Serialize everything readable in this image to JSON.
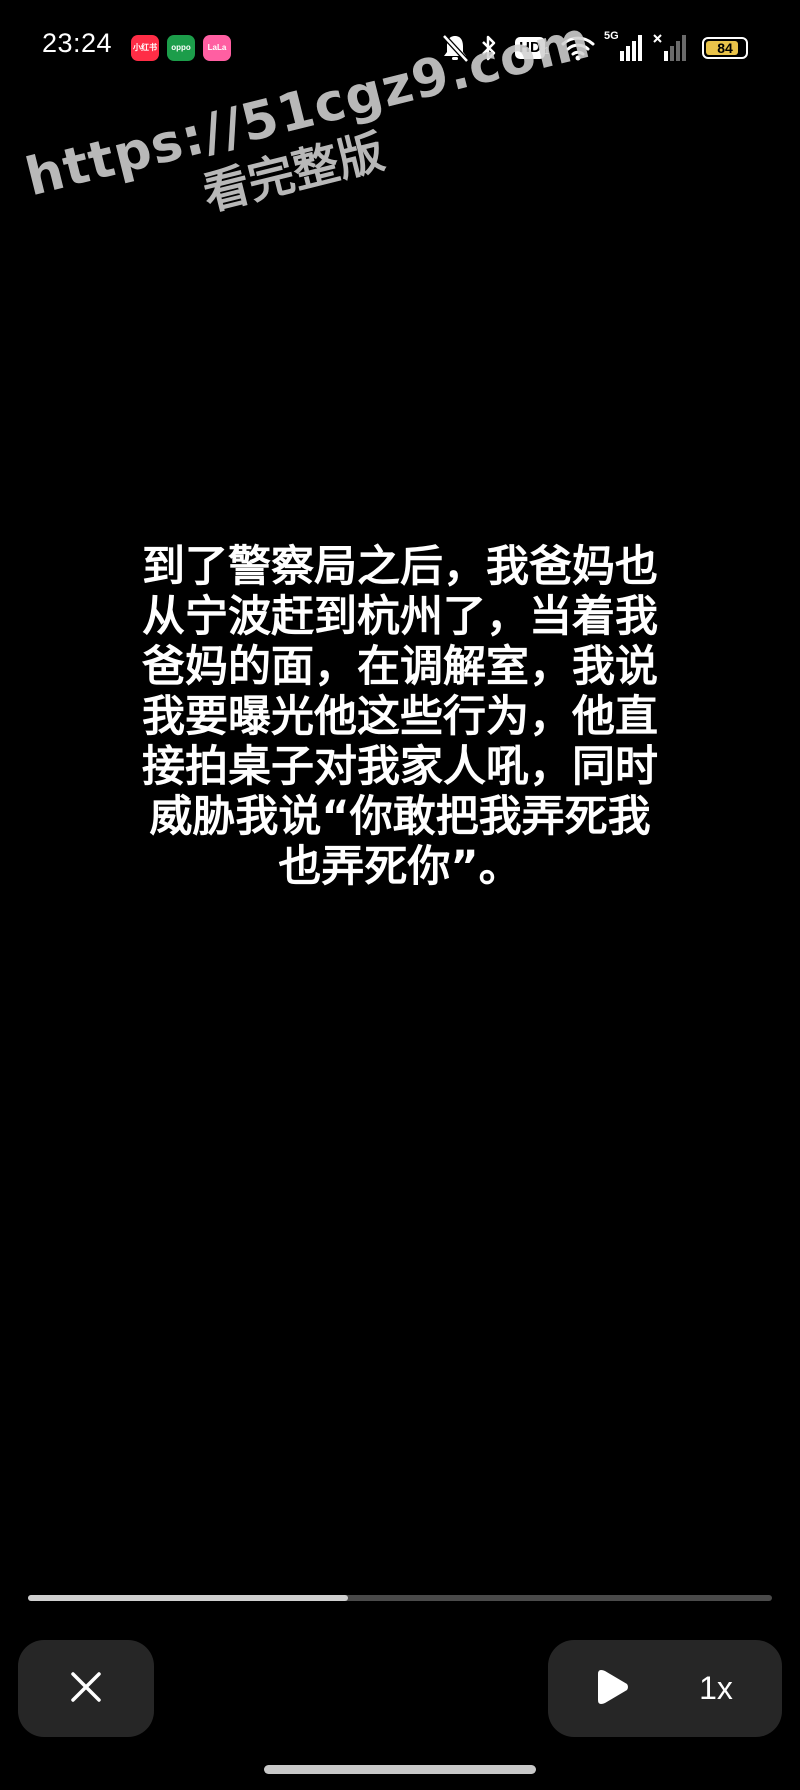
{
  "status_bar": {
    "time": "23:24",
    "app_badges": [
      {
        "text": "小红书",
        "color": "#ff2d46"
      },
      {
        "text": "oppo",
        "color": "#1c9d4a"
      },
      {
        "text": "LaLa",
        "color": "#ff5fa2"
      }
    ],
    "hd_label": "HD",
    "hd_sub": "1",
    "network_label": "5G",
    "battery_level": "84",
    "battery_fraction": 0.84,
    "icons": [
      "bell-mute-icon",
      "bluetooth-icon",
      "hd-icon",
      "wifi-icon",
      "signal-5g-icon",
      "signal-no-service-icon",
      "battery-icon"
    ]
  },
  "watermark": {
    "url": "https://51cgz9.com",
    "sub": "看完整版"
  },
  "caption": {
    "lines": [
      "到了警察局之后，我爸妈也",
      "从宁波赶到杭州了，当着我",
      "爸妈的面，在调解室，我说",
      "我要曝光他这些行为，他直",
      "接拍桌子对我家人吼，同时",
      "威胁我说“你敢把我弄死我",
      "也弄死你”。"
    ]
  },
  "player": {
    "progress_fraction": 0.43,
    "speed_label": "1x",
    "close_icon": "close-icon",
    "play_icon": "play-icon"
  },
  "colors": {
    "background": "#000000",
    "control_bg": "#262626",
    "progress_fill": "#cfcfcf",
    "progress_track": "#4a4a4a",
    "battery_fill": "#e9c34a"
  }
}
